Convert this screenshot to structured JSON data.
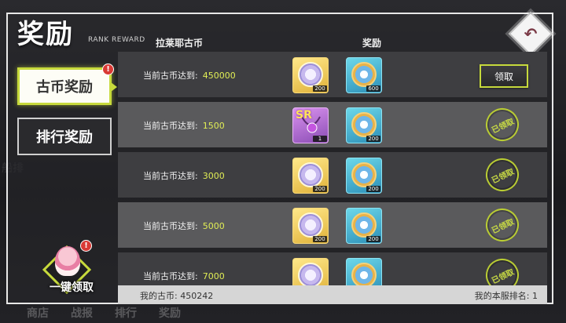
{
  "title": "奖励",
  "title_sub": "RANK REWARD",
  "tabs": [
    {
      "label": "古币奖励",
      "active": true,
      "badge": "!"
    },
    {
      "label": "排行奖励",
      "active": false
    }
  ],
  "one_key": {
    "label": "一键领取",
    "badge": "!"
  },
  "columns": {
    "currency": "拉莱耶古币",
    "reward": "奖励"
  },
  "row_prefix": "当前古币达到:",
  "rows": [
    {
      "threshold": "450000",
      "items": [
        {
          "icon": "gold-disc-icon",
          "qty": "200"
        },
        {
          "icon": "blue-compass-icon",
          "qty": "600"
        }
      ],
      "status": "claim",
      "action_label": "领取"
    },
    {
      "threshold": "1500",
      "items": [
        {
          "icon": "sr-necklace-icon",
          "qty": "1",
          "text": "SR"
        },
        {
          "icon": "blue-compass-icon",
          "qty": "200"
        }
      ],
      "status": "claimed",
      "action_label": "已领取"
    },
    {
      "threshold": "3000",
      "items": [
        {
          "icon": "gold-disc-icon",
          "qty": "200"
        },
        {
          "icon": "blue-compass-icon",
          "qty": "200"
        }
      ],
      "status": "claimed",
      "action_label": "已领取"
    },
    {
      "threshold": "5000",
      "items": [
        {
          "icon": "gold-disc-icon",
          "qty": "200"
        },
        {
          "icon": "blue-compass-icon",
          "qty": "200"
        }
      ],
      "status": "claimed",
      "action_label": "已领取"
    },
    {
      "threshold": "7000",
      "items": [
        {
          "icon": "gold-disc-icon",
          "qty": ""
        },
        {
          "icon": "blue-compass-icon",
          "qty": ""
        }
      ],
      "status": "claimed",
      "action_label": "已领取"
    }
  ],
  "footer": {
    "coins_label": "我的古币:",
    "coins_value": "450242",
    "rank_label": "我的本服排名:",
    "rank_value": "1"
  },
  "bottom_nav": [
    "商店",
    "战报",
    "排行",
    "奖励"
  ],
  "colors": {
    "accent": "#c7da3c",
    "value_text": "#e1ee55",
    "badge": "#d93a35"
  }
}
